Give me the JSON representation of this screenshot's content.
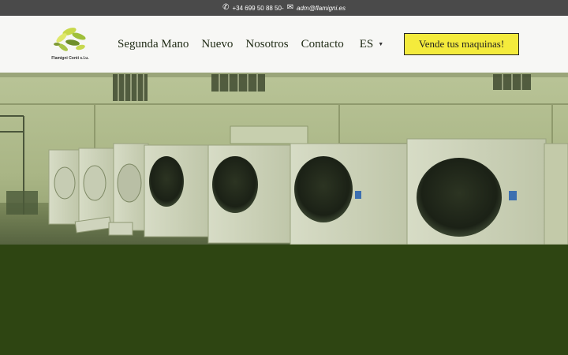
{
  "topbar": {
    "phone_icon": "phone-icon",
    "phone": "+34 699 50 88 50-",
    "mail_icon": "mail-icon",
    "email": "adm@flamigni.es"
  },
  "header": {
    "logo_text": "Flamigni Conti s.l.u.",
    "nav": [
      {
        "label": "Segunda Mano"
      },
      {
        "label": "Nuevo"
      },
      {
        "label": "Nosotros"
      },
      {
        "label": "Contacto"
      }
    ],
    "language": "ES",
    "cta_label": "Vende tus maquinas!"
  },
  "colors": {
    "topbar": "#4a4a4a",
    "header": "#f7f7f5",
    "cta": "#f4eb3c",
    "band": "#2e4512"
  }
}
